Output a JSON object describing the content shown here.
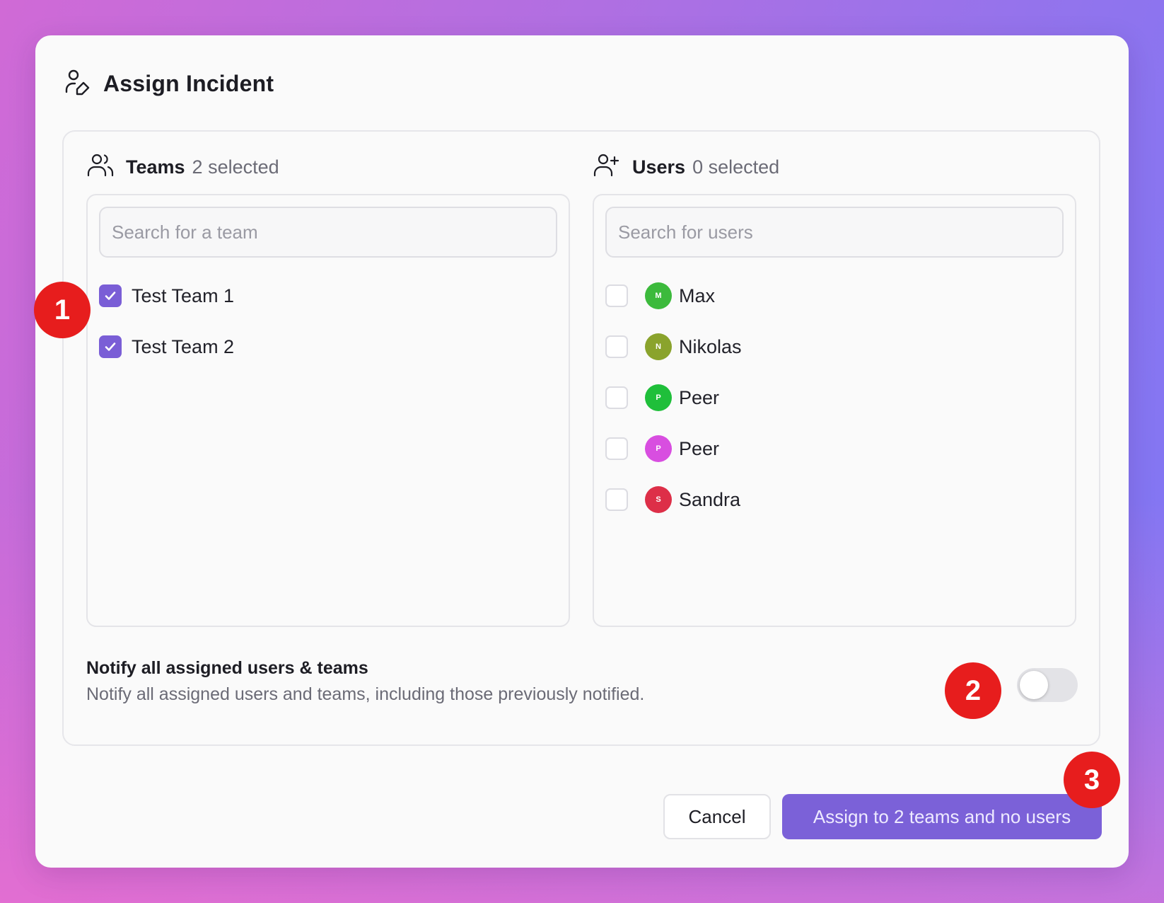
{
  "modal": {
    "title": "Assign Incident",
    "title_icon": "user-edit-icon"
  },
  "teams": {
    "label": "Teams",
    "count_text": "2 selected",
    "icon": "users-group-icon",
    "search_placeholder": "Search for a team",
    "items": [
      {
        "label": "Test Team 1",
        "checked": true
      },
      {
        "label": "Test Team 2",
        "checked": true
      }
    ]
  },
  "users": {
    "label": "Users",
    "count_text": "0 selected",
    "icon": "user-plus-icon",
    "search_placeholder": "Search for users",
    "items": [
      {
        "label": "Max",
        "initial": "M",
        "color": "#3cba3c",
        "checked": false
      },
      {
        "label": "Nikolas",
        "initial": "N",
        "color": "#8aa32c",
        "checked": false
      },
      {
        "label": "Peer",
        "initial": "P",
        "color": "#1fbf3a",
        "checked": false
      },
      {
        "label": "Peer",
        "initial": "P",
        "color": "#d84ee0",
        "checked": false
      },
      {
        "label": "Sandra",
        "initial": "S",
        "color": "#dd2f48",
        "checked": false
      }
    ]
  },
  "notify": {
    "title": "Notify all assigned users & teams",
    "description": "Notify all assigned users and teams, including those previously notified.",
    "enabled": false
  },
  "buttons": {
    "cancel": "Cancel",
    "assign": "Assign to 2 teams and no users"
  },
  "annotations": [
    "1",
    "2",
    "3"
  ],
  "colors": {
    "accent": "#7b61d8",
    "badge": "#e71d1d"
  }
}
